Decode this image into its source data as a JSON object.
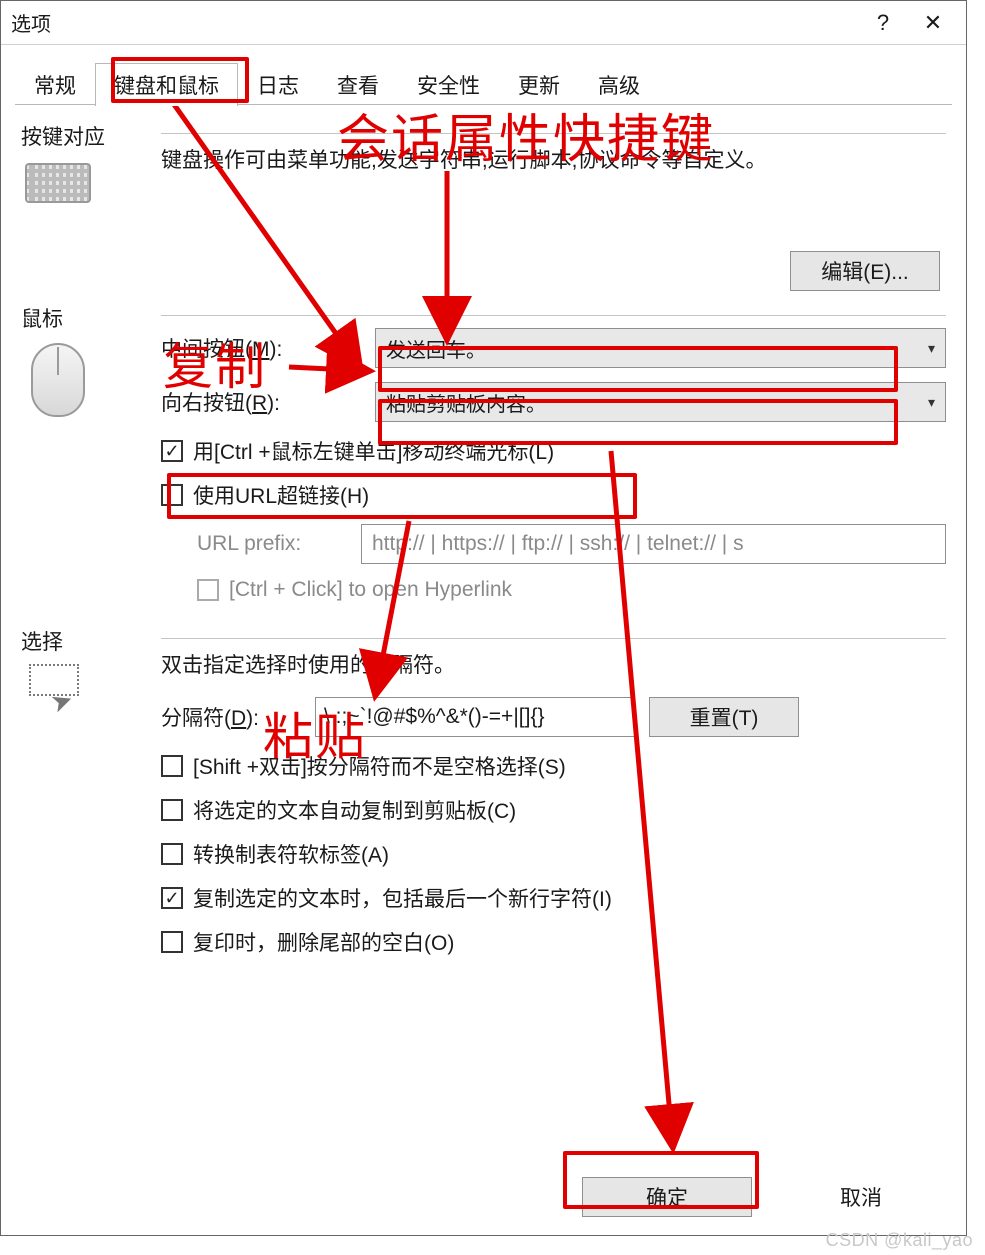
{
  "window": {
    "title": "选项",
    "help_glyph": "?",
    "close_glyph": "✕"
  },
  "tabs": [
    "常规",
    "键盘和鼠标",
    "日志",
    "查看",
    "安全性",
    "更新",
    "高级"
  ],
  "active_tab": "键盘和鼠标",
  "section_key": {
    "title": "按键对应",
    "desc": "键盘操作可由菜单功能,发送字符串,运行脚本,协议命令等自定义。",
    "edit_button": "编辑(E)..."
  },
  "section_mouse": {
    "title": "鼠标",
    "middle_label_pre": "中间按钮(",
    "middle_label_ul": "M",
    "middle_label_post": "):",
    "middle_value": "发送回车。",
    "right_label_pre": "向右按钮(",
    "right_label_ul": "R",
    "right_label_post": "):",
    "right_value": "粘贴剪贴板内容。",
    "chk_ctrlclick": "用[Ctrl +鼠标左键单击]移动终端光标(L)",
    "chk_url": "使用URL超链接(H)",
    "url_prefix_label": "URL prefix:",
    "url_prefix_value": "http:// | https:// | ftp:// | ssh:// | telnet:// | s",
    "chk_ctrl_hyperlink": "[Ctrl + Click] to open Hyperlink"
  },
  "section_select": {
    "title": "选择",
    "desc": "双击指定选择时使用的分隔符。",
    "delim_label_pre": "分隔符(",
    "delim_label_ul": "D",
    "delim_label_post": "):",
    "delim_value": "\\ :;~`!@#$%^&*()-=+|[]{}",
    "reset_button": "重置(T)",
    "chk_shift": "[Shift +双击]按分隔符而不是空格选择(S)",
    "chk_autocopy": "将选定的文本自动复制到剪贴板(C)",
    "chk_tab": "转换制表符软标签(A)",
    "chk_newline": "复制选定的文本时，包括最后一个新行字符(I)",
    "chk_trim": "复印时，删除尾部的空白(O)"
  },
  "footer": {
    "ok": "确定",
    "cancel": "取消"
  },
  "annotations": {
    "big_title": "会话属性快捷键",
    "copy": "复制",
    "paste": "粘贴"
  },
  "watermark": "CSDN @kali_yao"
}
